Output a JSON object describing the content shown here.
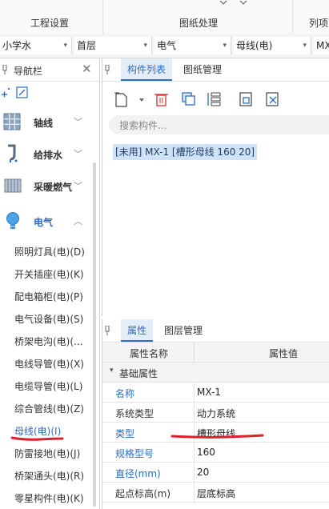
{
  "ribbon": {
    "groups": [
      "工程设置",
      "图纸处理",
      "列项"
    ]
  },
  "selectors": [
    {
      "value": "小学水"
    },
    {
      "value": "首层"
    },
    {
      "value": "电气"
    },
    {
      "value": "母线(电)"
    },
    {
      "value": "MX"
    }
  ],
  "nav": {
    "title": "导航栏",
    "categories": [
      {
        "label": "轴线",
        "icon": "grid-icon"
      },
      {
        "label": "给排水",
        "icon": "pipe-icon"
      },
      {
        "label": "采暖燃气",
        "icon": "radiator-icon"
      },
      {
        "label": "电气",
        "icon": "lightbulb-icon"
      }
    ],
    "items": [
      "照明灯具(电)(D)",
      "开关插座(电)(K)",
      "配电箱柜(电)(P)",
      "电气设备(电)(S)",
      "桥架电沟(电)(...",
      "电线导管(电)(X)",
      "电缆导管(电)(L)",
      "综合管线(电)(Z)",
      "母线(电)(I)",
      "防雷接地(电)(J)",
      "桥架通头(电)(R)",
      "零星构件(电)(K)"
    ]
  },
  "component_panel": {
    "tabs": [
      "构件列表",
      "图纸管理"
    ],
    "search_placeholder": "搜索构件...",
    "items": [
      "[未用] MX-1 [槽形母线 160 20]"
    ]
  },
  "properties_panel": {
    "tabs": [
      "属性",
      "图层管理"
    ],
    "columns": [
      "属性名称",
      "属性值"
    ],
    "group": "基础属性",
    "rows": [
      {
        "name": "名称",
        "value": "MX-1",
        "name_color": "#2b6cc4"
      },
      {
        "name": "系统类型",
        "value": "动力系统",
        "name_color": "#333333"
      },
      {
        "name": "类型",
        "value": "槽形母线",
        "name_color": "#2b6cc4"
      },
      {
        "name": "规格型号",
        "value": "160",
        "name_color": "#2b6cc4"
      },
      {
        "name": "直径(mm)",
        "value": "20",
        "name_color": "#2b6cc4"
      },
      {
        "name": "起点标高(m)",
        "value": "层底标高",
        "name_color": "#333333"
      }
    ]
  },
  "colors": {
    "accent": "#2b6cc4",
    "annotation": "#e01e2c",
    "selected_bg": "#cfe2f7",
    "tab_active_bg": "#e4eef9"
  }
}
